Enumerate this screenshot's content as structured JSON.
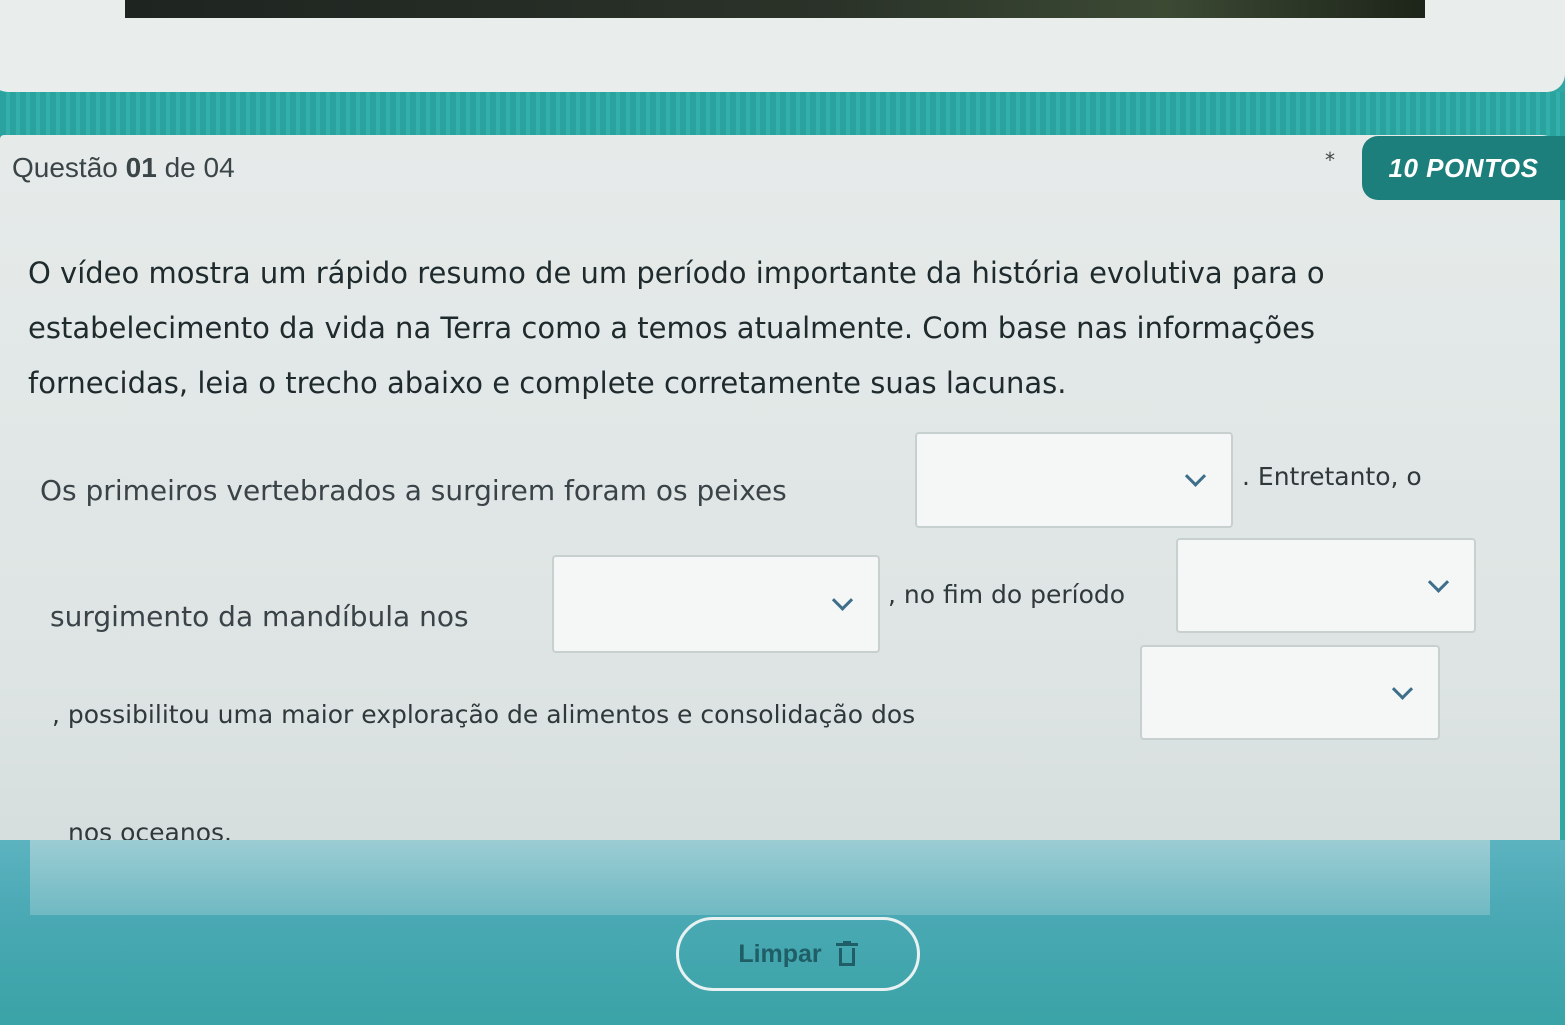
{
  "question": {
    "label_prefix": "Questão",
    "number": "01",
    "label_suffix": "de 04",
    "required_marker": "*",
    "points": "10 PONTOS"
  },
  "prompt": "O vídeo mostra um rápido resumo de um período importante da história evolutiva para o estabelecimento da vida na Terra como a temos atualmente. Com base nas informações fornecidas, leia o trecho abaixo e complete corretamente suas lacunas.",
  "fill_text": {
    "part1": "Os primeiros vertebrados a surgirem foram os peixes",
    "part2": ". Entretanto, o",
    "part3": "surgimento da mandíbula nos",
    "part4": ", no fim do período",
    "part5": ", possibilitou uma maior exploração de alimentos e consolidação dos",
    "part6": "nos oceanos."
  },
  "dropdowns": [
    {
      "id": "blank-1",
      "value": ""
    },
    {
      "id": "blank-2",
      "value": ""
    },
    {
      "id": "blank-3",
      "value": ""
    },
    {
      "id": "blank-4",
      "value": ""
    }
  ],
  "actions": {
    "clear_label": "Limpar",
    "clear_icon": "trash-icon"
  },
  "colors": {
    "background_teal": "#2fa8a4",
    "badge": "#1c7f7b",
    "card": "#e6ebea"
  }
}
